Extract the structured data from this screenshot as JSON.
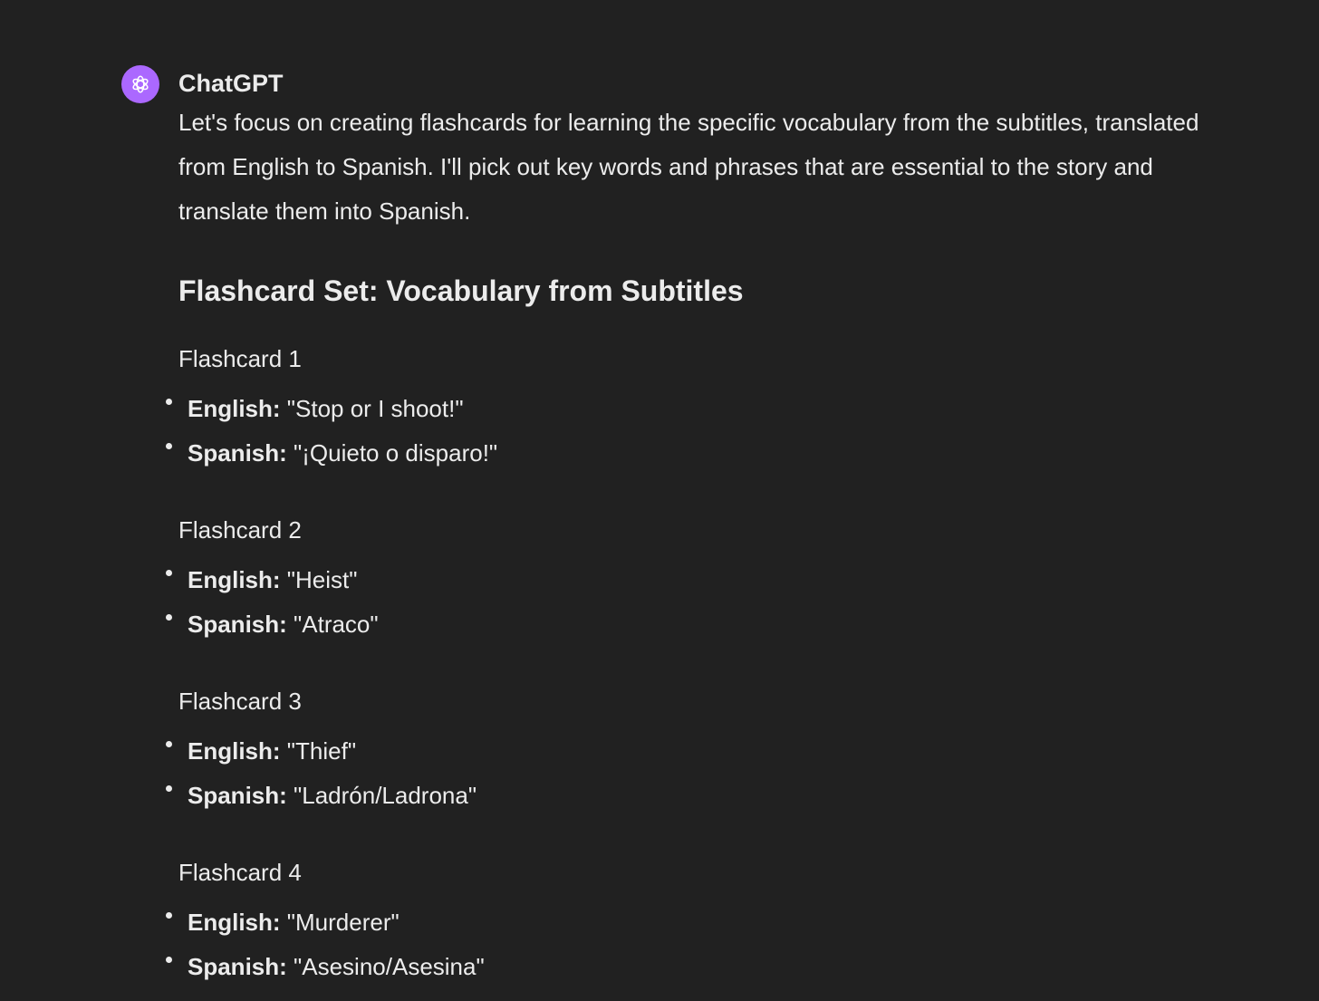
{
  "message": {
    "author": "ChatGPT",
    "avatar_icon": "openai-logo-icon",
    "avatar_color": "#ab68ff",
    "intro": "Let's focus on creating flashcards for learning the specific vocabulary from the subtitles, translated from English to Spanish. I'll pick out key words and phrases that are essential to the story and translate them into Spanish.",
    "heading": "Flashcard Set: Vocabulary from Subtitles",
    "flashcards": [
      {
        "title": "Flashcard 1",
        "english_label": "English:",
        "english_value": " \"Stop or I shoot!\"",
        "spanish_label": "Spanish:",
        "spanish_value": " \"¡Quieto o disparo!\""
      },
      {
        "title": "Flashcard 2",
        "english_label": "English:",
        "english_value": " \"Heist\"",
        "spanish_label": "Spanish:",
        "spanish_value": " \"Atraco\""
      },
      {
        "title": "Flashcard 3",
        "english_label": "English:",
        "english_value": " \"Thief\"",
        "spanish_label": "Spanish:",
        "spanish_value": " \"Ladrón/Ladrona\""
      },
      {
        "title": "Flashcard 4",
        "english_label": "English:",
        "english_value": " \"Murderer\"",
        "spanish_label": "Spanish:",
        "spanish_value": " \"Asesino/Asesina\""
      }
    ]
  }
}
